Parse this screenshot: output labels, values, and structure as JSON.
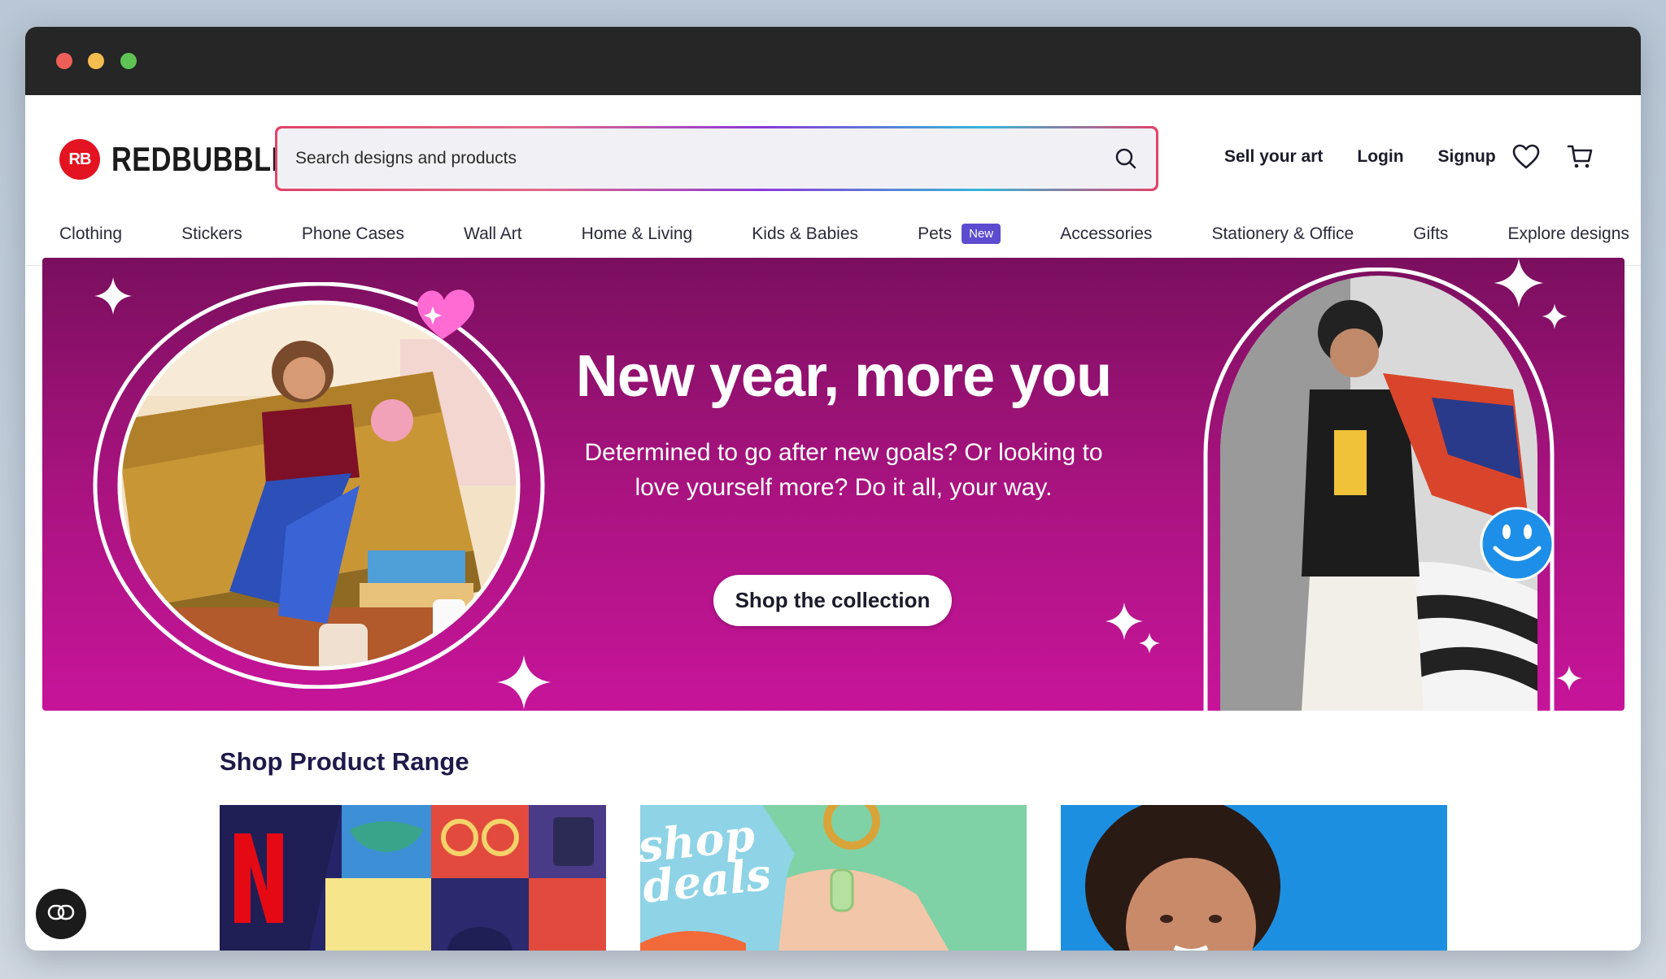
{
  "brand": {
    "name": "REDBUBBLE",
    "badge": "RB",
    "color": "#e41321"
  },
  "search": {
    "placeholder": "Search designs and products"
  },
  "header": {
    "links": [
      "Sell your art",
      "Login",
      "Signup"
    ],
    "icons": [
      "heart-icon",
      "cart-icon"
    ]
  },
  "nav": {
    "items": [
      "Clothing",
      "Stickers",
      "Phone Cases",
      "Wall Art",
      "Home & Living",
      "Kids & Babies",
      "Pets",
      "Accessories",
      "Stationery & Office",
      "Gifts",
      "Explore designs"
    ],
    "pets_badge": "New"
  },
  "hero": {
    "title": "New year, more you",
    "subtitle": "Determined to go after new goals? Or looking to love yourself more? Do it all, your way.",
    "cta": "Shop the collection",
    "colors": {
      "top": "#7a0f5e",
      "bottom": "#c7149a"
    }
  },
  "range": {
    "title": "Shop Product Range",
    "card2_text": "shop deals"
  },
  "chat": {
    "icon": "chat-icon"
  }
}
